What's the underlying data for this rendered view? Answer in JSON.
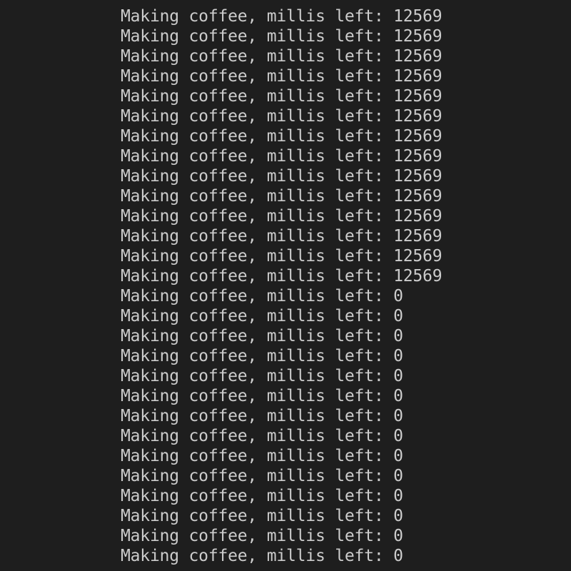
{
  "terminal": {
    "background": "#1e1e1e",
    "foreground": "#cccccc",
    "lines": [
      "Making coffee, millis left: 12569",
      "Making coffee, millis left: 12569",
      "Making coffee, millis left: 12569",
      "Making coffee, millis left: 12569",
      "Making coffee, millis left: 12569",
      "Making coffee, millis left: 12569",
      "Making coffee, millis left: 12569",
      "Making coffee, millis left: 12569",
      "Making coffee, millis left: 12569",
      "Making coffee, millis left: 12569",
      "Making coffee, millis left: 12569",
      "Making coffee, millis left: 12569",
      "Making coffee, millis left: 12569",
      "Making coffee, millis left: 12569",
      "Making coffee, millis left: 0",
      "Making coffee, millis left: 0",
      "Making coffee, millis left: 0",
      "Making coffee, millis left: 0",
      "Making coffee, millis left: 0",
      "Making coffee, millis left: 0",
      "Making coffee, millis left: 0",
      "Making coffee, millis left: 0",
      "Making coffee, millis left: 0",
      "Making coffee, millis left: 0",
      "Making coffee, millis left: 0",
      "Making coffee, millis left: 0",
      "Making coffee, millis left: 0",
      "Making coffee, millis left: 0"
    ]
  }
}
